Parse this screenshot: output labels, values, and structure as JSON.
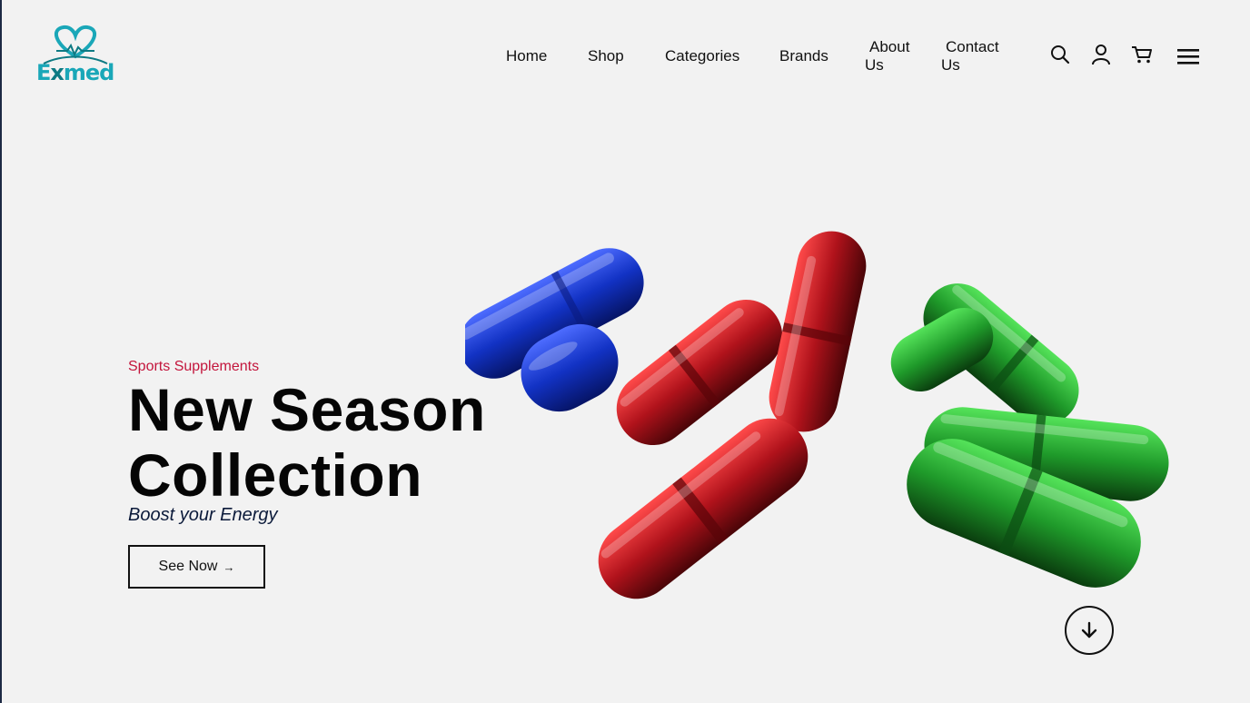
{
  "brand": {
    "name_prefix": "E",
    "name_x": "x",
    "name_suffix": "med"
  },
  "nav": {
    "items": [
      {
        "label": "Home"
      },
      {
        "label": "Shop"
      },
      {
        "label": "Categories"
      },
      {
        "label": "Brands"
      },
      {
        "label_line1": "About",
        "label_line2": "Us"
      },
      {
        "label_line1": "Contact",
        "label_line2": "Us"
      }
    ],
    "icons": [
      "search-icon",
      "user-icon",
      "cart-icon",
      "menu-icon"
    ]
  },
  "hero": {
    "tag": "Sports Supplements",
    "title_line1": "New Season",
    "title_line2": "Collection",
    "subtitle": "Boost your Energy",
    "cta_label": "See Now",
    "cta_arrow": "→"
  },
  "colors": {
    "background": "#f2f2f2",
    "accent_red": "#c3153c",
    "logo_teal": "#1aa7b8",
    "pill_blue": "#1236c8",
    "pill_red": "#b0141c",
    "pill_green": "#1f9a2a"
  }
}
